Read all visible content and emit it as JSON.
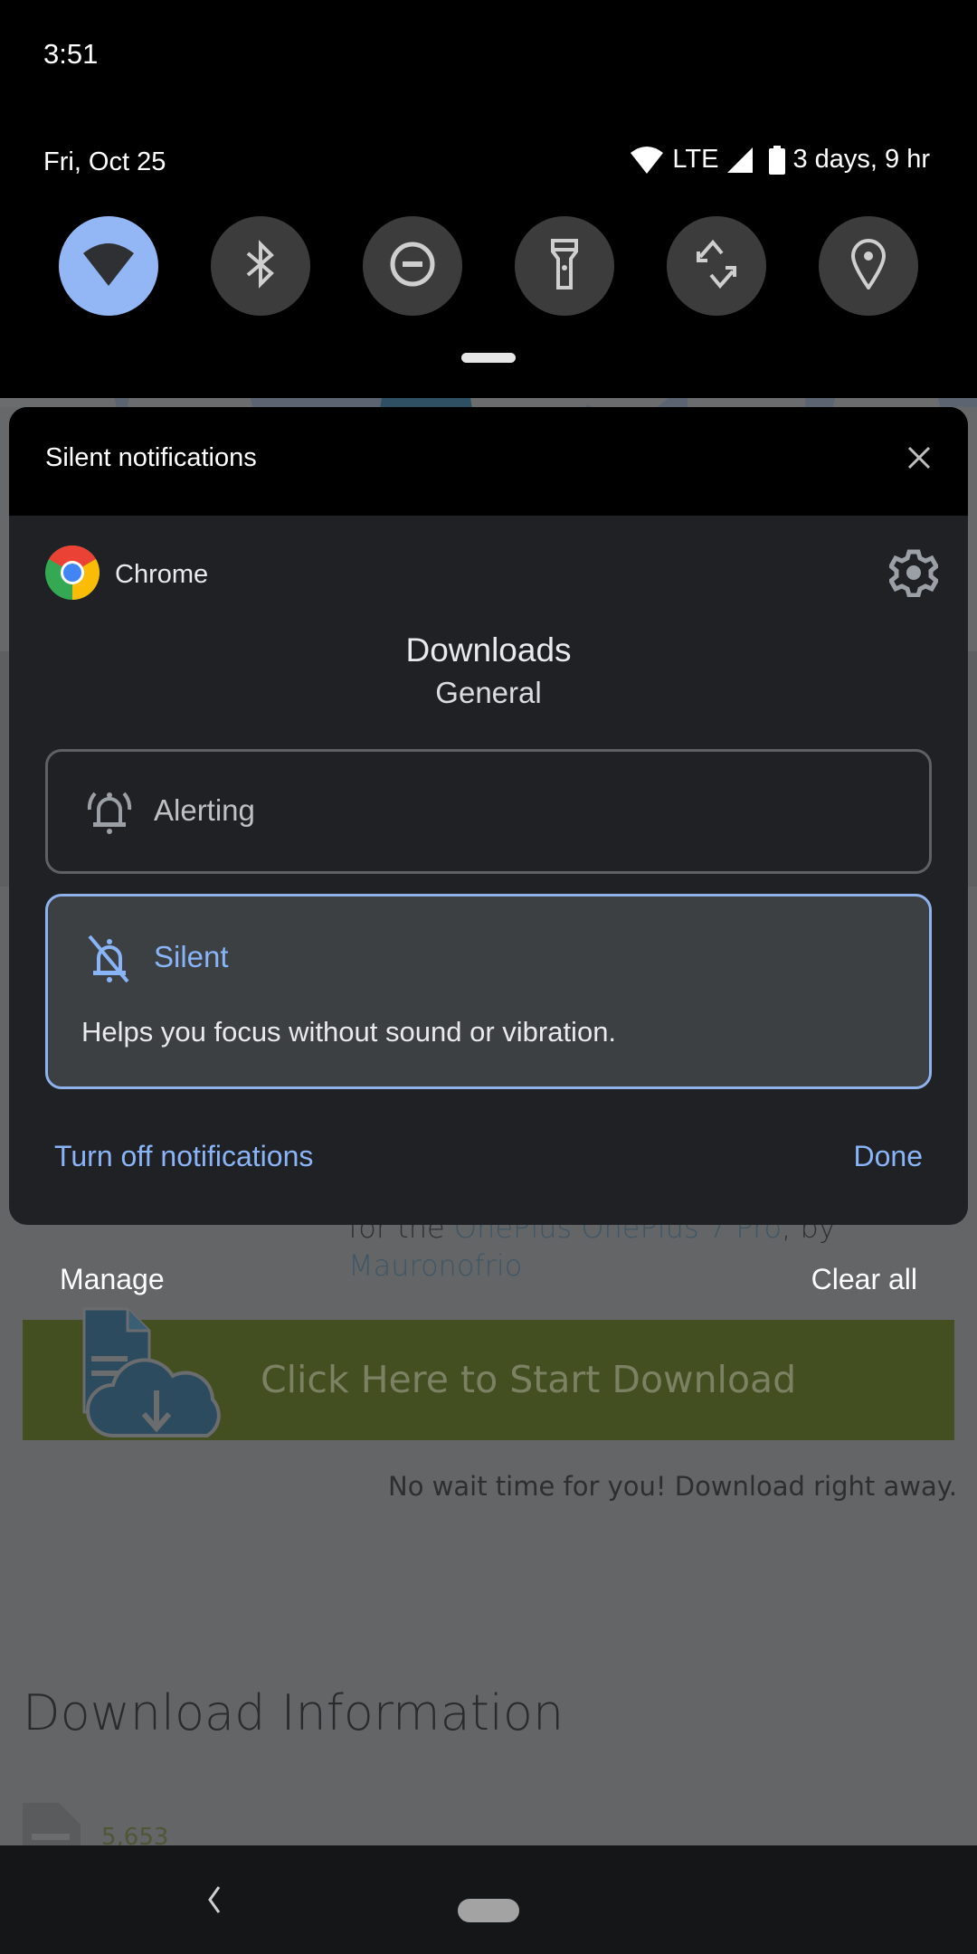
{
  "status_bar": {
    "time": "3:51"
  },
  "quick_settings": {
    "date": "Fri, Oct 25",
    "network_label": "LTE",
    "battery_text": "3 days, 9 hr",
    "tiles": [
      {
        "name": "wifi",
        "icon": "wifi-icon",
        "active": true
      },
      {
        "name": "bluetooth",
        "icon": "bluetooth-icon",
        "active": false
      },
      {
        "name": "do-not-disturb",
        "icon": "dnd-icon",
        "active": false
      },
      {
        "name": "flashlight",
        "icon": "flashlight-icon",
        "active": false
      },
      {
        "name": "auto-rotate",
        "icon": "rotate-icon",
        "active": false
      },
      {
        "name": "location",
        "icon": "location-icon",
        "active": false
      }
    ]
  },
  "notification": {
    "section_title": "Silent notifications",
    "app_name": "Chrome",
    "channel_title": "Downloads",
    "channel_group": "General",
    "options": {
      "alerting": {
        "label": "Alerting",
        "selected": false
      },
      "silent": {
        "label": "Silent",
        "description": "Helps you focus without sound or vibration.",
        "selected": true
      }
    },
    "actions": {
      "turn_off": "Turn off notifications",
      "done": "Done"
    },
    "accent_color": "#8ab4f8"
  },
  "shade_footer": {
    "manage": "Manage",
    "clear_all": "Clear all"
  },
  "background_page": {
    "text_prefix": "for the ",
    "link_device": "OnePlus OnePlus 7 Pro",
    "text_by": ", by ",
    "link_author": "Mauronofrio",
    "download_button": "Click Here to Start Download",
    "no_wait": "No wait time for you! Download right away.",
    "section_heading": "Download Information",
    "download_count": "5,653"
  }
}
